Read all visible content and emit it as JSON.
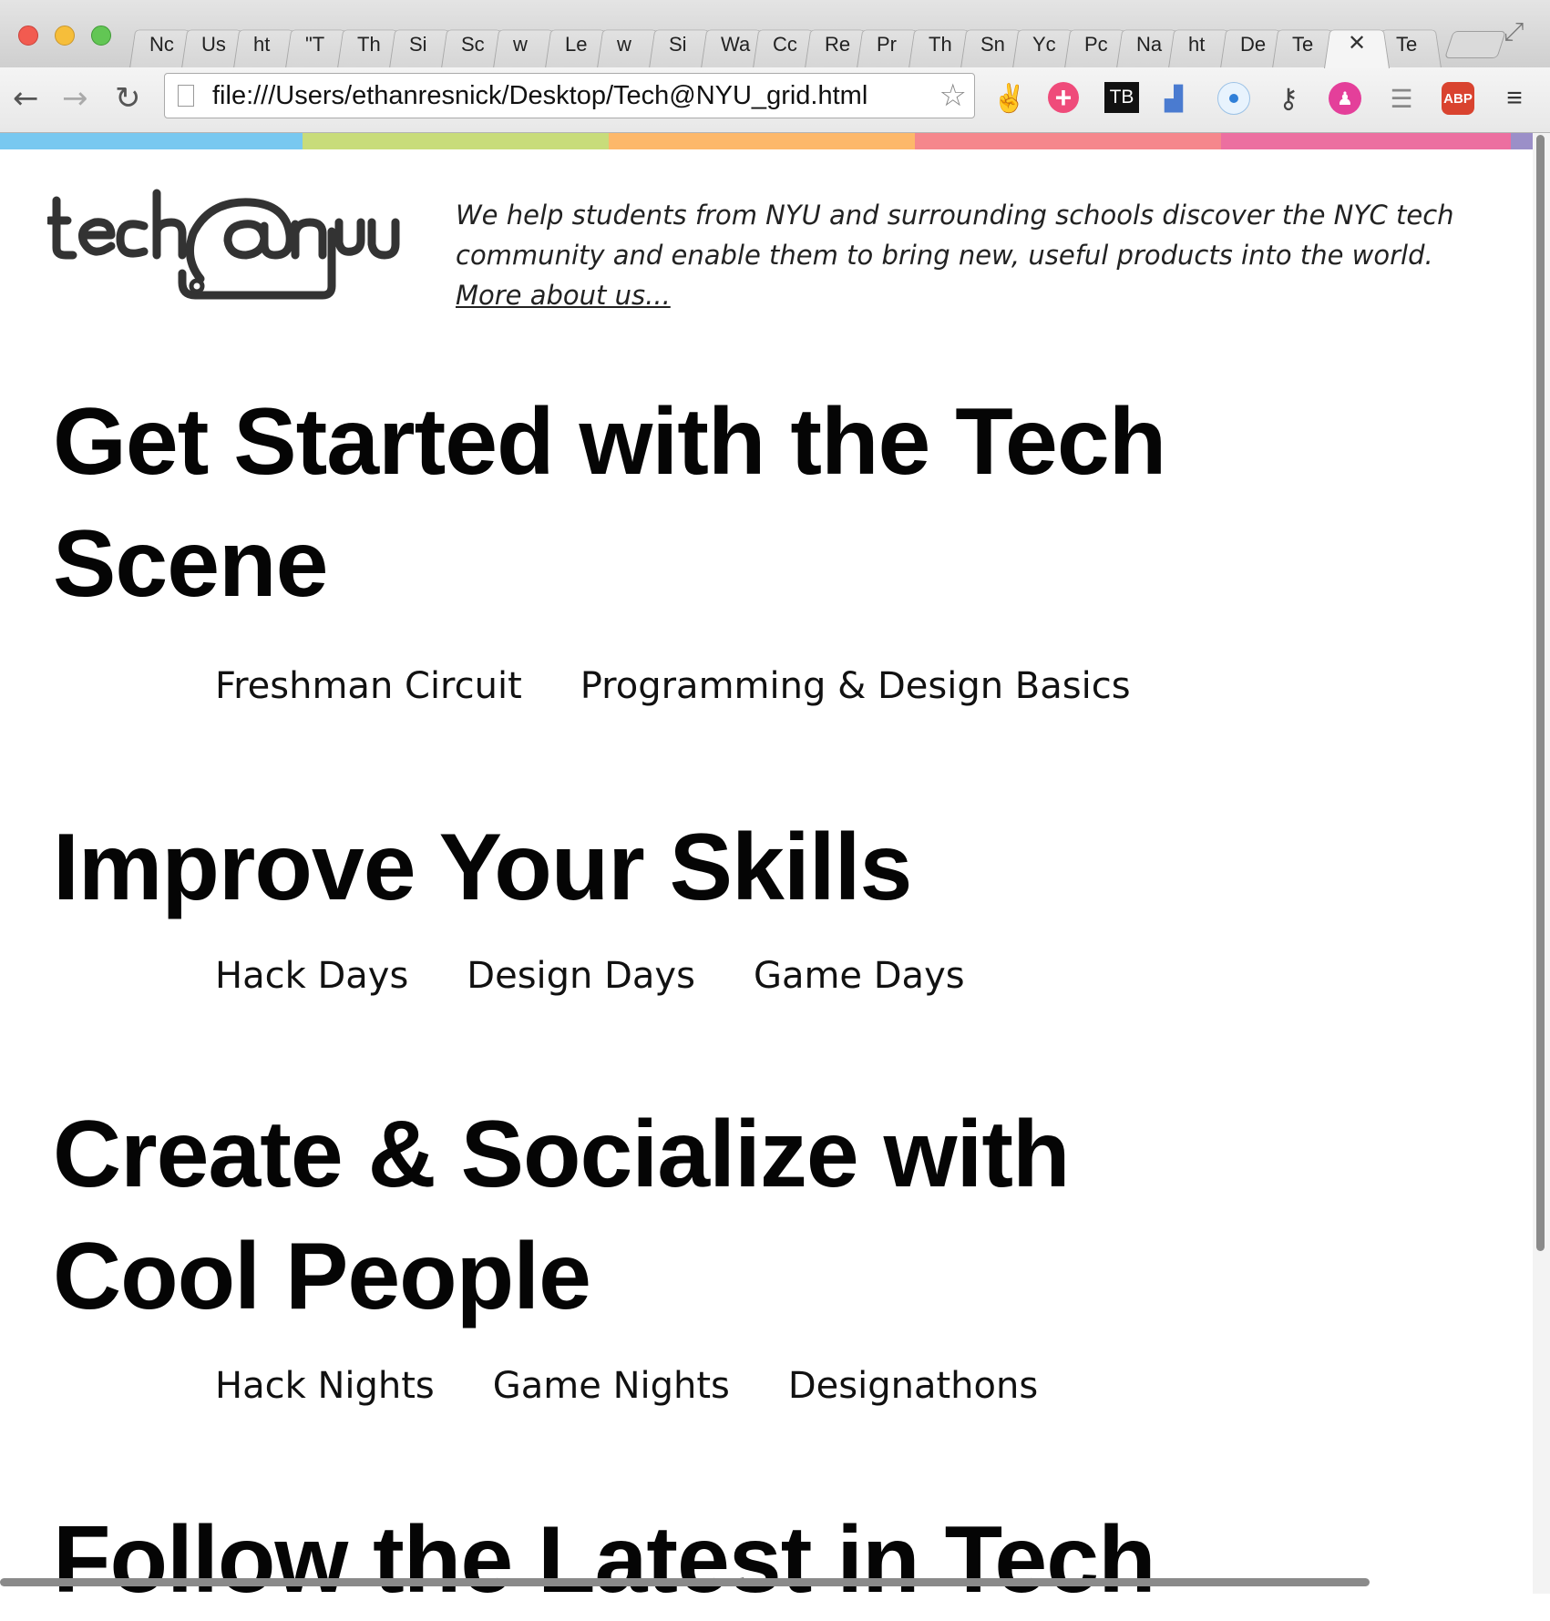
{
  "browser": {
    "tabs": [
      "Nc",
      "Us",
      "ht",
      "\"T",
      "Th",
      "Si",
      "Sc",
      "w",
      "Le",
      "w",
      "Si",
      "Wa",
      "Cc",
      "Re",
      "Pr",
      "Th",
      "Sn",
      "Yc",
      "Pc",
      "Na",
      "ht",
      "De",
      "Te",
      "",
      "Te"
    ],
    "active_tab_close": "✕",
    "address": "file:///Users/ethanresnick/Desktop/Tech@NYU_grid.html",
    "extensions": [
      "peace-icon",
      "plus-icon",
      "TB",
      "chart-icon",
      "dot-icon",
      "key-icon",
      "pink-icon",
      "stack-icon",
      "ABP",
      "menu-icon"
    ],
    "ext_tb_label": "TB",
    "ext_abp_label": "ABP"
  },
  "colorbar": [
    "#78c8f0",
    "#c8dc7a",
    "#fdb86a",
    "#f5878c",
    "#ec6fa0",
    "#9b8fc8"
  ],
  "brand": {
    "logo_text": "tech@nyu",
    "tagline": "We help students from NYU and surrounding schools discover the NYC tech community and enable them to bring new, useful products into the world.",
    "more_link": "More about us..."
  },
  "sections": [
    {
      "title": "Get Started with the Tech Scene",
      "links": [
        "Freshman Circuit",
        "Programming & Design Basics"
      ]
    },
    {
      "title": "Improve Your Skills",
      "links": [
        "Hack Days",
        "Design Days",
        "Game Days"
      ]
    },
    {
      "title": "Create & Socialize with Cool People",
      "links": [
        "Hack Nights",
        "Game Nights",
        "Designathons"
      ]
    },
    {
      "title": "Follow the Latest in Tech"
    }
  ]
}
